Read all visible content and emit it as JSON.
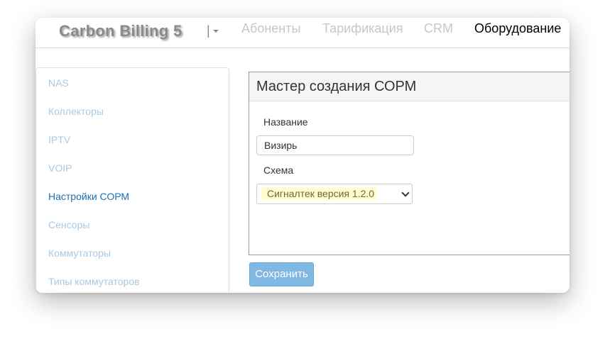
{
  "app": {
    "brand": "Carbon Billing 5"
  },
  "nav": {
    "dropdown_label": "|",
    "items": [
      {
        "label": "Абоненты"
      },
      {
        "label": "Тарификация"
      },
      {
        "label": "CRM"
      },
      {
        "label": "Оборудование",
        "active": true
      }
    ]
  },
  "sidebar": {
    "items": [
      {
        "label": "NAS"
      },
      {
        "label": "Коллекторы"
      },
      {
        "label": "IPTV"
      },
      {
        "label": "VOIP"
      },
      {
        "label": "Настройки СОРМ",
        "active": true
      },
      {
        "label": "Сенсоры"
      },
      {
        "label": "Коммутаторы"
      },
      {
        "label": "Типы коммутаторов"
      }
    ]
  },
  "form": {
    "title": "Мастер создания СОРМ",
    "name_label": "Название",
    "name_value": "Визирь",
    "scheme_label": "Схема",
    "scheme_value": "Сигналтек версия 1.2.0",
    "save_label": "Сохранить"
  },
  "colors": {
    "active_sidebar": "#1a6fb5",
    "inactive_sidebar": "#a9c9e2",
    "save_button": "#7fb8e2",
    "select_highlight": "#fdfdd0"
  }
}
